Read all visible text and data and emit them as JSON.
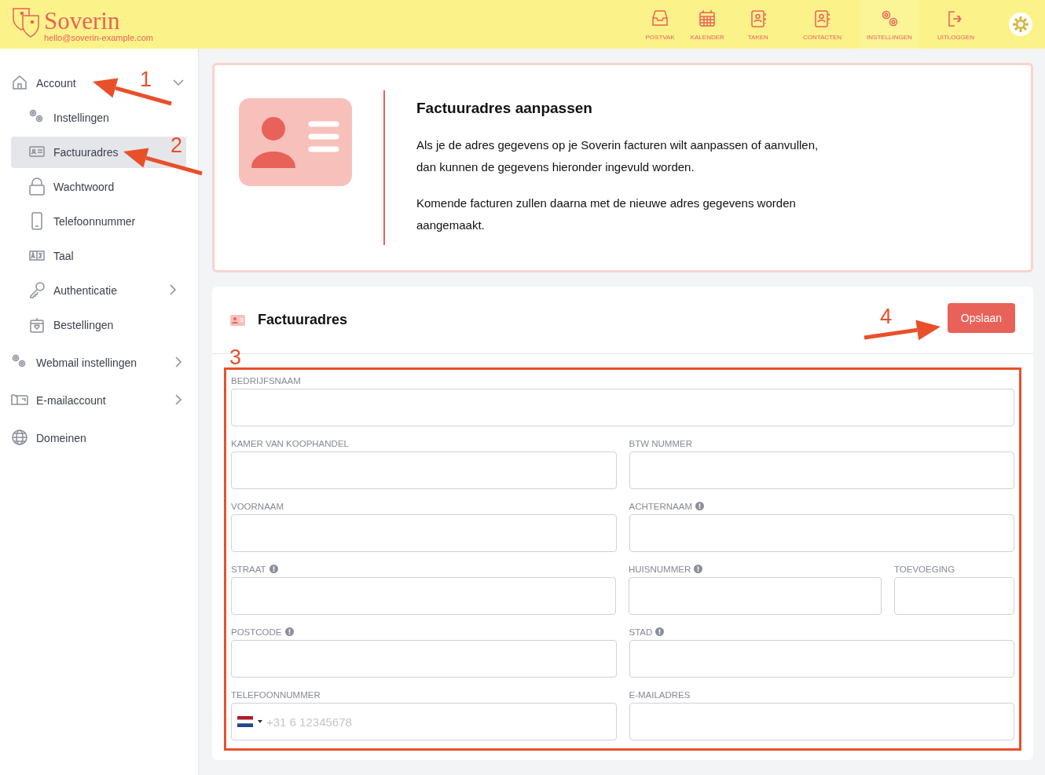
{
  "header": {
    "logo": "Soverin",
    "email": "hello@soverin-example.com",
    "nav": [
      {
        "label": "POSTVAK",
        "selected": false
      },
      {
        "label": "KALENDER",
        "selected": false
      },
      {
        "label": "TAKEN",
        "selected": false
      },
      {
        "label": "CONTACTEN",
        "selected": false
      },
      {
        "label": "INSTELLINGEN",
        "selected": true
      },
      {
        "label": "UITLOGGEN",
        "selected": false
      }
    ]
  },
  "sidebar": {
    "items": [
      {
        "label": "Account",
        "kind": "group",
        "expanded": true,
        "selected": false,
        "children": [
          {
            "label": "Instellingen",
            "kind": "link",
            "selected": false
          },
          {
            "label": "Factuuradres",
            "kind": "link",
            "selected": true
          },
          {
            "label": "Wachtwoord",
            "kind": "link",
            "selected": false
          },
          {
            "label": "Telefoonnummer",
            "kind": "link",
            "selected": false
          },
          {
            "label": "Taal",
            "kind": "link",
            "selected": false
          },
          {
            "label": "Authenticatie",
            "kind": "group",
            "expanded": false,
            "selected": false
          },
          {
            "label": "Bestellingen",
            "kind": "link",
            "selected": false
          }
        ]
      },
      {
        "label": "Webmail instellingen",
        "kind": "group",
        "expanded": false,
        "selected": false
      },
      {
        "label": "E-mailaccount",
        "kind": "group",
        "expanded": false,
        "selected": false
      },
      {
        "label": "Domeinen",
        "kind": "link",
        "selected": false
      }
    ]
  },
  "intro": {
    "title": "Factuuradres aanpassen",
    "paragraphs": [
      "Als je de adres gegevens op je Soverin facturen wilt aanpassen of aanvullen, dan kunnen de gegevens hieronder ingevuld worden.",
      "Komende facturen zullen daarna met de nieuwe adres gegevens worden aangemaakt."
    ]
  },
  "form": {
    "title": "Factuuradres",
    "save_button": "Opslaan",
    "rows": [
      [
        {
          "label": "BEDRIJFSNAAM",
          "info": false,
          "kind": "text"
        }
      ],
      [
        {
          "label": "KAMER VAN KOOPHANDEL",
          "info": false,
          "kind": "text"
        },
        {
          "label": "BTW NUMMER",
          "info": false,
          "kind": "text"
        }
      ],
      [
        {
          "label": "VOORNAAM",
          "info": false,
          "kind": "text"
        },
        {
          "label": "ACHTERNAAM",
          "info": true,
          "kind": "text"
        }
      ],
      [
        {
          "label": "STRAAT",
          "info": true,
          "kind": "text"
        },
        {
          "label": "HUISNUMMER",
          "info": true,
          "kind": "text"
        },
        {
          "label": "TOEVOEGING",
          "info": false,
          "kind": "small"
        }
      ],
      [
        {
          "label": "POSTCODE",
          "info": true,
          "kind": "text"
        },
        {
          "label": "STAD",
          "info": true,
          "kind": "text"
        }
      ],
      [
        {
          "label": "TELEFOONNUMMER",
          "info": false,
          "kind": "phone",
          "placeholder": "+31 6 12345678"
        },
        {
          "label": "E-MAILADRES",
          "info": false,
          "kind": "text"
        }
      ]
    ]
  },
  "annotations": [
    {
      "label": "1"
    },
    {
      "label": "2"
    },
    {
      "label": "3"
    },
    {
      "label": "4"
    }
  ]
}
